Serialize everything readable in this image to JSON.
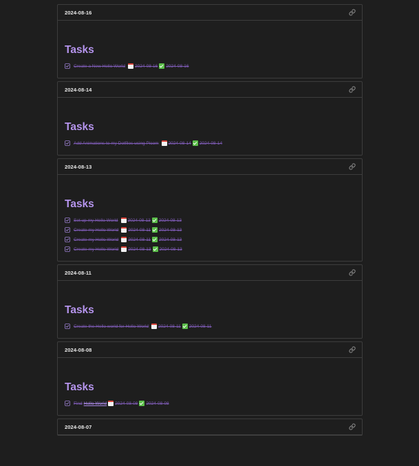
{
  "cards": [
    {
      "date": "2024-08-16",
      "section_title": "Tasks",
      "tasks": [
        {
          "text": "Create a New Hello World",
          "due": "2024-08-16",
          "done": "2024-08-16"
        }
      ]
    },
    {
      "date": "2024-08-14",
      "section_title": "Tasks",
      "tasks": [
        {
          "text": "Add Animations to my Dotfiles using Picom",
          "due": "2024-08-14",
          "done": "2024-08-14"
        }
      ]
    },
    {
      "date": "2024-08-13",
      "section_title": "Tasks",
      "tasks": [
        {
          "text": "Set up my Hello World",
          "due": "2024-08-13",
          "done": "2024-08-13"
        },
        {
          "text": "Create my Hello World",
          "due": "2024-08-11",
          "done": "2024-08-13"
        },
        {
          "text": "Create my Hello World",
          "due": "2024-08-11",
          "done": "2024-08-13"
        },
        {
          "text": "Create my Hello World",
          "due": "2024-08-13",
          "done": "2024-08-13"
        }
      ]
    },
    {
      "date": "2024-08-11",
      "section_title": "Tasks",
      "tasks": [
        {
          "text": "Create the Hello world for Hello World",
          "due": "2024-08-11",
          "done": "2024-08-11"
        }
      ]
    },
    {
      "date": "2024-08-08",
      "section_title": "Tasks",
      "tasks": [
        {
          "text": "Find",
          "link": "Hello World",
          "due": "2024-08-08",
          "done": "2024-08-08"
        }
      ]
    },
    {
      "date": "2024-08-07",
      "section_title": "",
      "tasks": []
    }
  ],
  "icons": {
    "card_link": "link-icon",
    "task_checkbox": "checked-checkbox-icon",
    "due_date": "calendar-icon",
    "done_date": "check-mark-button-icon"
  },
  "colors": {
    "background": "#1e1e1e",
    "border": "#3d3d3d",
    "accent": "#b594ed",
    "task_done_text": "#7e5bb5"
  }
}
